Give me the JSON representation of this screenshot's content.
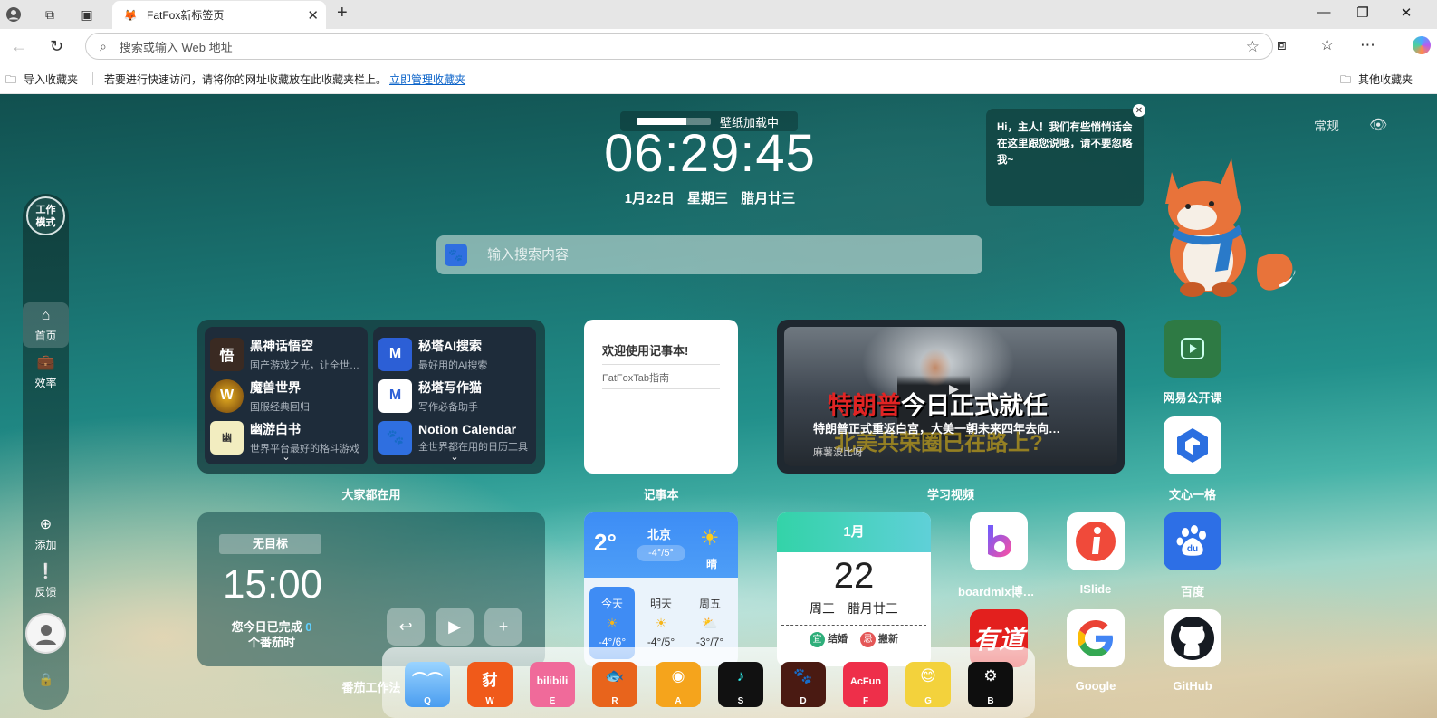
{
  "browser": {
    "tab_title": "FatFox新标签页",
    "address_placeholder": "搜索或输入 Web 地址",
    "favbar": {
      "import": "导入收藏夹",
      "hint": "若要进行快速访问，请将你的网址收藏放在此收藏夹栏上。",
      "manage_link": "立即管理收藏夹",
      "other": "其他收藏夹"
    }
  },
  "sidebar": {
    "work_mode": "工作模式",
    "items": [
      {
        "label": "首页",
        "icon": "home-icon"
      },
      {
        "label": "效率",
        "icon": "briefcase-icon"
      },
      {
        "label": "添加",
        "icon": "plus-icon"
      },
      {
        "label": "反馈",
        "icon": "feedback-icon"
      }
    ]
  },
  "header": {
    "wallpaper_loading": "壁纸加载中",
    "wallpaper_progress": 0.67,
    "time": "06:29:45",
    "date": {
      "day": "1月22日",
      "weekday": "星期三",
      "lunar": "腊月廿三"
    },
    "search_placeholder": "输入搜索内容"
  },
  "mascot": {
    "bubble": "Hi，主人！我们有些悄悄话会在这里跟您说哦，请不要忽略我~",
    "mode_label": "常规"
  },
  "common_widget": {
    "label": "大家都在用",
    "left": [
      {
        "name": "黑神话悟空",
        "desc": "国产游戏之光，让全世界都看到"
      },
      {
        "name": "魔兽世界",
        "desc": "国服经典回归"
      },
      {
        "name": "幽游白书",
        "desc": "世界平台最好的格斗游戏"
      }
    ],
    "right": [
      {
        "name": "秘塔AI搜索",
        "desc": "最好用的AI搜索"
      },
      {
        "name": "秘塔写作猫",
        "desc": "写作必备助手"
      },
      {
        "name": "Notion Calendar",
        "desc": "全世界都在用的日历工具"
      }
    ]
  },
  "notes_widget": {
    "label": "记事本",
    "title": "欢迎使用记事本!",
    "line": "FatFoxTab指南"
  },
  "video_widget": {
    "label": "学习视频",
    "title_red": "特朗普",
    "title_white": "今日正式就任",
    "subtitle": "北美共荣圈已在路上?",
    "desc": "特朗普正式重返白宫，大美一朝未来四年去向…",
    "author": "麻薯波比呀"
  },
  "right_icons": [
    {
      "label": "网易公开课"
    },
    {
      "label": "文心一格"
    },
    {
      "label": "boardmix博思白板"
    },
    {
      "label": "ISlide"
    },
    {
      "label": "百度"
    },
    {
      "label": "有道"
    },
    {
      "label": "Google"
    },
    {
      "label": "GitHub"
    }
  ],
  "pomodoro": {
    "label": "番茄工作法",
    "goal": "无目标",
    "time": "15:00",
    "done_prefix": "您今日已完成",
    "done_count": "0",
    "done_suffix": "个番茄时"
  },
  "weather": {
    "temp": "2°",
    "city": "北京",
    "range": "-4°/5°",
    "condition": "晴",
    "days": [
      {
        "name": "今天",
        "range": "-4°/6°"
      },
      {
        "name": "明天",
        "range": "-4°/5°"
      },
      {
        "name": "周五",
        "range": "-3°/7°"
      }
    ]
  },
  "calendar": {
    "month": "1月",
    "day": "22",
    "weekday": "周三",
    "lunar": "腊月廿三",
    "good_badge": "宜",
    "good": "结婚",
    "bad_badge": "忌",
    "bad": "搬新"
  },
  "dock": [
    {
      "key": "Q"
    },
    {
      "key": "W"
    },
    {
      "key": "E"
    },
    {
      "key": "R"
    },
    {
      "key": "A"
    },
    {
      "key": "S"
    },
    {
      "key": "D"
    },
    {
      "key": "F"
    },
    {
      "key": "G"
    },
    {
      "key": "B"
    }
  ]
}
